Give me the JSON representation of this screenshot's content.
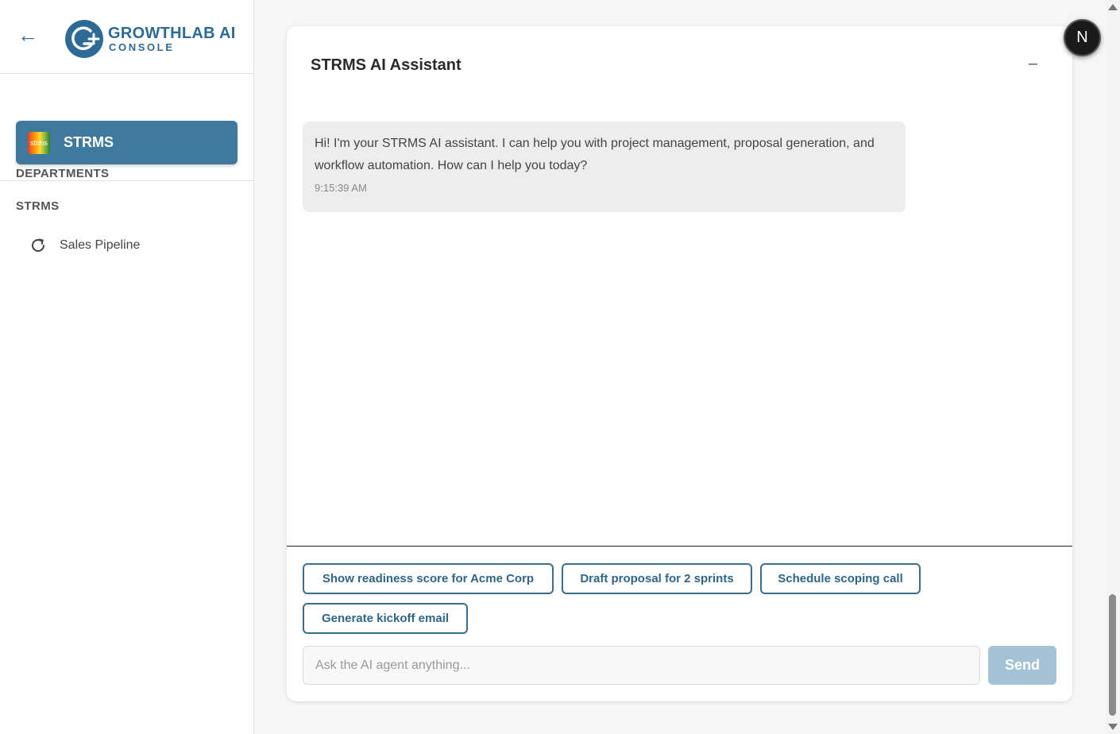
{
  "app": {
    "logo_title": "GROWTHLAB AI",
    "logo_subtitle": "CONSOLE",
    "brand_color": "#2d6b96"
  },
  "sidebar": {
    "departments_title": "DEPARTMENTS",
    "department": {
      "label": "STRMS",
      "logo_text": "strms"
    },
    "section_title": "STRMS",
    "items": [
      {
        "label": "Sales Pipeline",
        "icon": "refresh-icon"
      }
    ]
  },
  "chat": {
    "title": "STRMS AI Assistant",
    "minimize_label": "–",
    "messages": [
      {
        "text": "Hi! I'm your STRMS AI assistant. I can help you with project management, proposal generation, and workflow automation. How can I help you today?",
        "time": "9:15:39 AM"
      }
    ],
    "suggestions": [
      "Show readiness score for Acme Corp",
      "Draft proposal for 2 sprints",
      "Schedule scoping call",
      "Generate kickoff email"
    ],
    "input_placeholder": "Ask the AI agent anything...",
    "send_label": "Send"
  },
  "user": {
    "avatar_initial": "N"
  }
}
